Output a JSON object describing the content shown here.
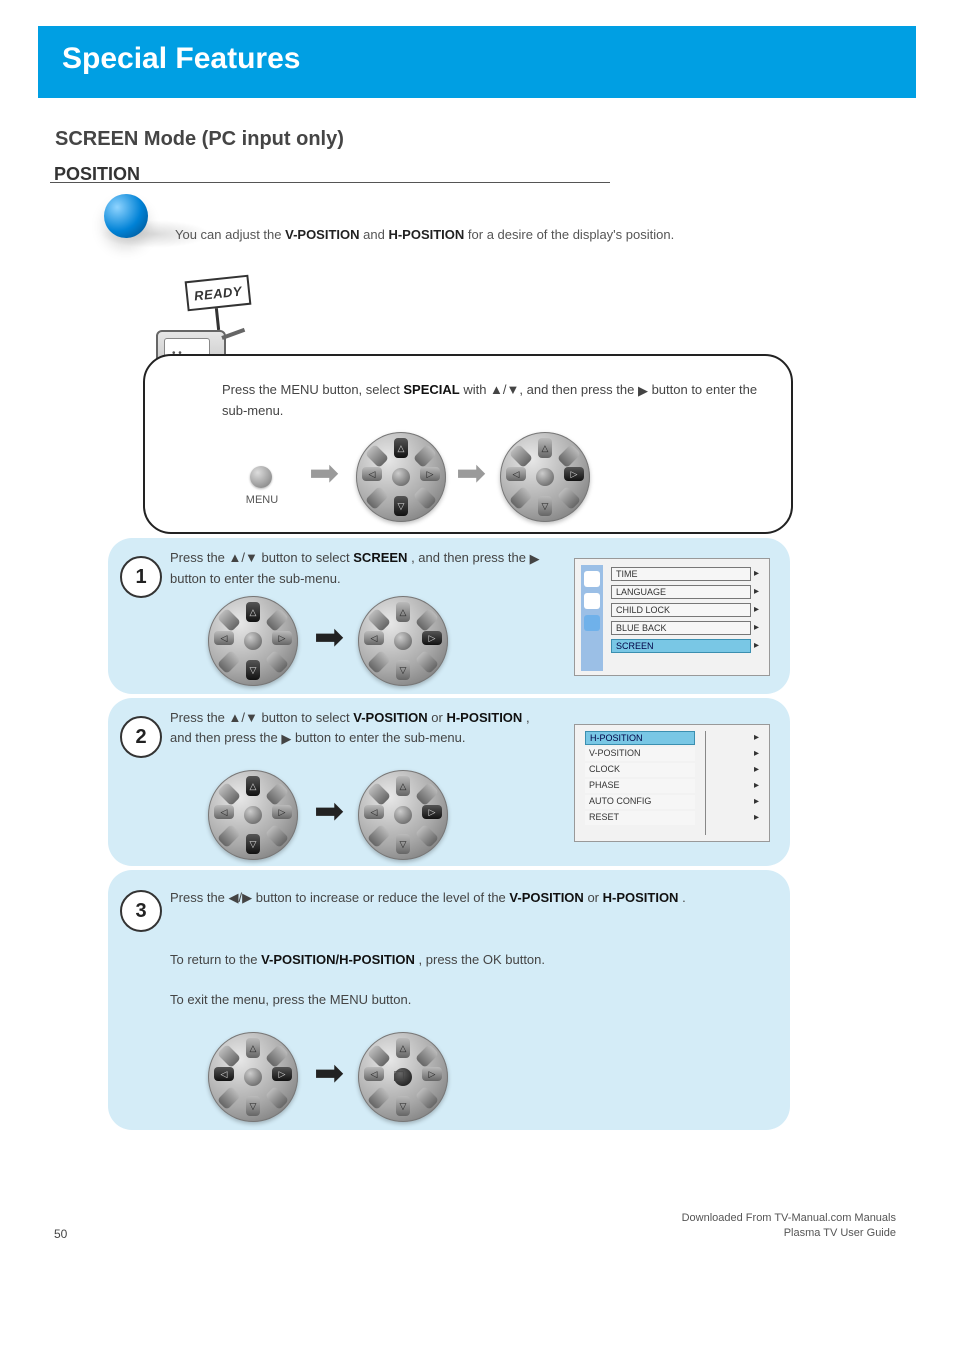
{
  "colors": {
    "accent": "#009FE3",
    "panel": "#D4ECF7"
  },
  "header": {
    "title": "Special Features",
    "subtitle": "SCREEN Mode (PC input only)"
  },
  "section": {
    "heading": "POSITION",
    "intro_pre": "You can adjust the ",
    "bold_v": "V-POSITION",
    "intro_mid": " and ",
    "bold_h": "H-POSITION",
    "intro_post": " for a desire of the display's position."
  },
  "ready": {
    "sign": "READY"
  },
  "speech": {
    "line1_pre": "Press the MENU button, select ",
    "line1_bold": "SPECIAL",
    "line1_mid": " with ▲/▼, and then press the ",
    "tri": "▶",
    "line1_end": " button to enter the sub-menu."
  },
  "dpad": {
    "up": "△",
    "down": "▽",
    "left": "◁",
    "right": "▷",
    "ok": "□"
  },
  "buttons": {
    "menu_label": "MENU"
  },
  "steps": {
    "s1": {
      "num": "1",
      "pre": "Press the ▲/▼ button to select ",
      "bold": "SCREEN",
      "mid": ", and then press the ",
      "tri": "▶",
      "end": " button to enter the sub-menu."
    },
    "s2": {
      "num": "2",
      "pre": "Press the ▲/▼ button to select ",
      "bold_a": "V-POSITION",
      "mid1": " or ",
      "bold_b": "H-POSITION",
      "mid2": ", and then press the ",
      "tri": "▶",
      "end": " button to enter the sub-menu."
    },
    "s3": {
      "num": "3",
      "blk1_pre": "Press the ◀/▶ button to increase or reduce the level of the ",
      "blk1_bold_a": "V-POSITION",
      "blk1_mid": " or ",
      "blk1_bold_b": "H-POSITION",
      "blk1_end": ".",
      "blk2_pre": "To return to the ",
      "blk2_bold": "V-POSITION/H-POSITION",
      "blk2_end": ", press the OK button.",
      "blk3": "To exit the menu, press the MENU button."
    }
  },
  "osd1": {
    "rows": [
      "TIME",
      "LANGUAGE",
      "CHILD LOCK",
      "BLUE BACK",
      "SCREEN"
    ],
    "sel": 4
  },
  "osd2": {
    "rows": [
      "H-POSITION",
      "V-POSITION",
      "CLOCK",
      "PHASE",
      "AUTO CONFIG",
      "RESET"
    ],
    "sel": 0
  },
  "footer": {
    "page": "50",
    "guide_line1": "Downloaded From TV-Manual.com Manuals",
    "guide_line2": "Plasma TV User Guide"
  }
}
